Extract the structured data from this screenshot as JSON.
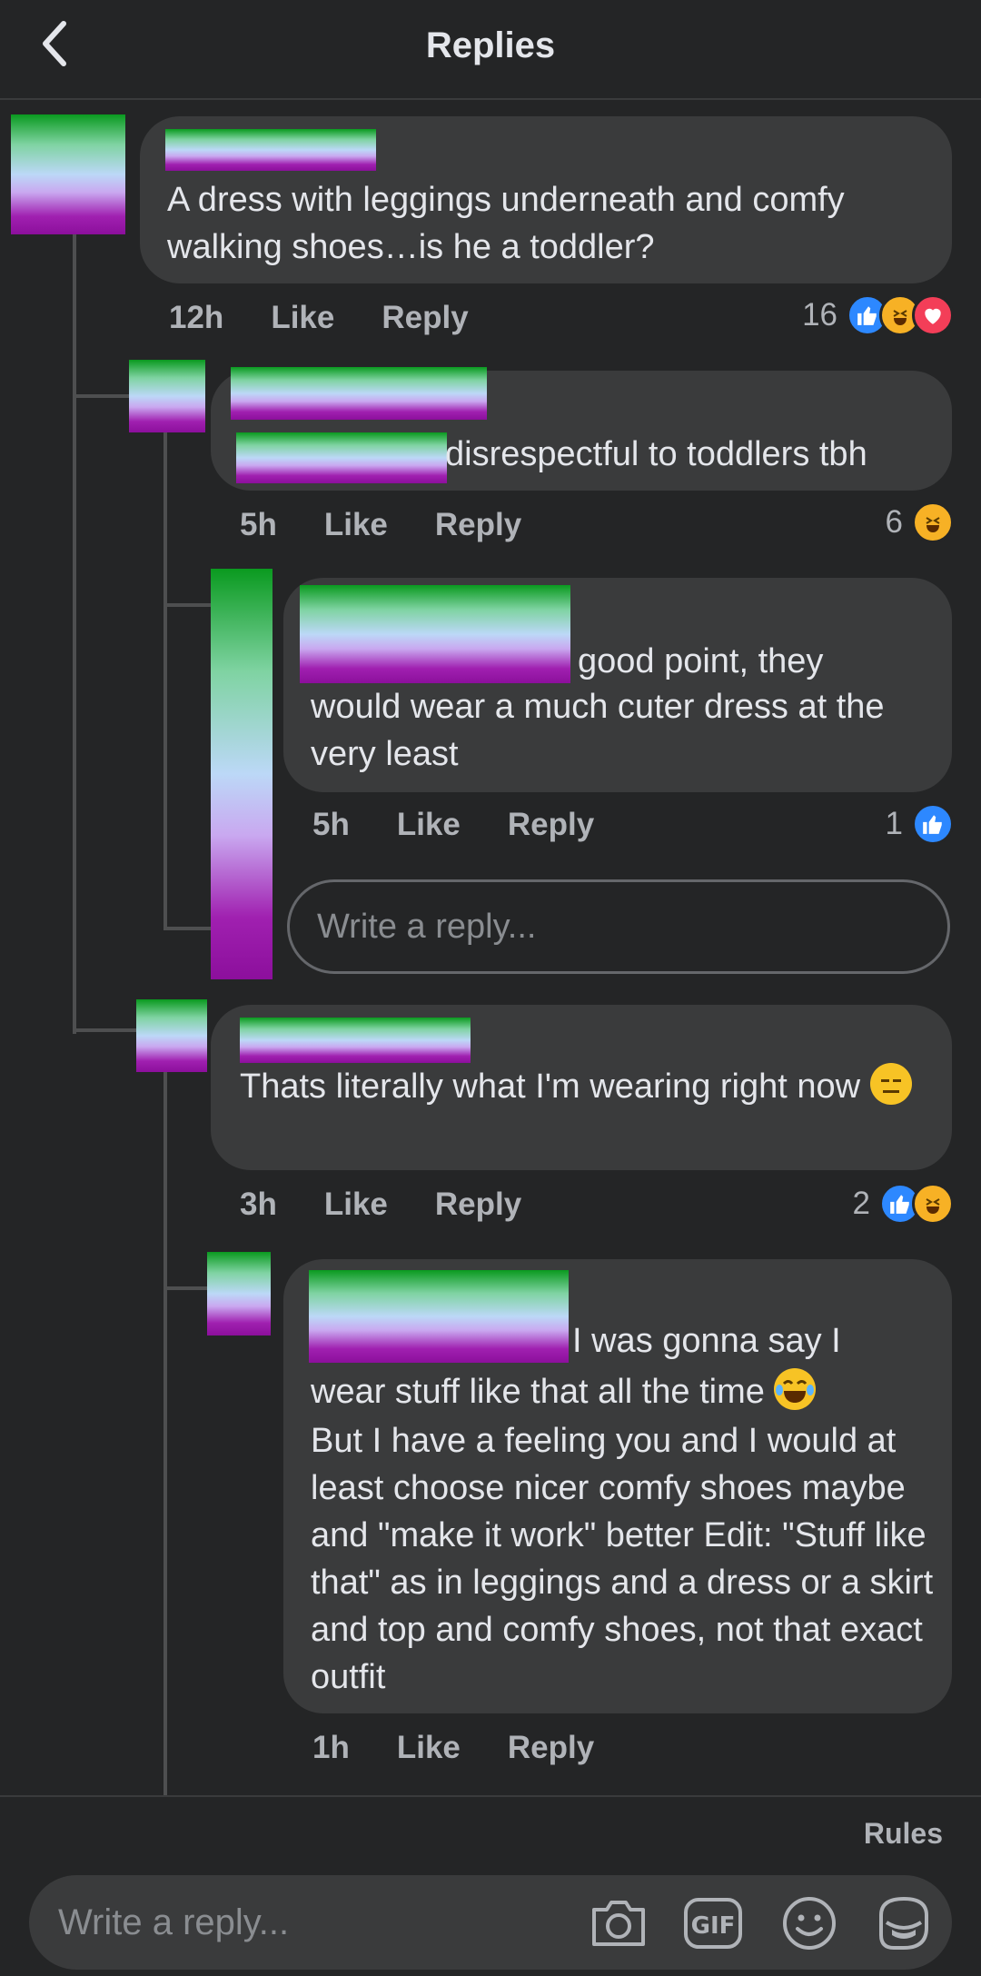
{
  "header": {
    "title": "Replies"
  },
  "comments": [
    {
      "text": "A dress with leggings underneath and comfy walking shoes…is he a toddler?",
      "time": "12h",
      "like": "Like",
      "reply": "Reply",
      "count": "16"
    },
    {
      "text": "disrespectful to toddlers tbh",
      "time": "5h",
      "like": "Like",
      "reply": "Reply",
      "count": "6"
    },
    {
      "text_line1": "good point, they",
      "text_rest": "would wear a much cuter dress at the very least",
      "time": "5h",
      "like": "Like",
      "reply": "Reply",
      "count": "1"
    },
    {
      "text": "Thats literally what I'm wearing right now",
      "time": "3h",
      "like": "Like",
      "reply": "Reply",
      "count": "2"
    },
    {
      "text_line1": "I was gonna say I",
      "text_line2": "wear stuff like that all the time",
      "text_rest": "But I have a feeling you and I would at least choose nicer comfy shoes maybe and \"make it work\" better Edit: \"Stuff like that\" as in leggings and a dress or a skirt and top and comfy shoes, not that exact outfit",
      "time": "1h",
      "like": "Like",
      "reply": "Reply"
    }
  ],
  "inline_reply": {
    "placeholder": "Write a reply..."
  },
  "composer": {
    "rules": "Rules",
    "placeholder": "Write a reply..."
  },
  "colors": {
    "like": "#2d88ff",
    "haha": "#f7b125",
    "love": "#f33e58",
    "bubble": "#3a3b3c",
    "background": "#242526"
  }
}
